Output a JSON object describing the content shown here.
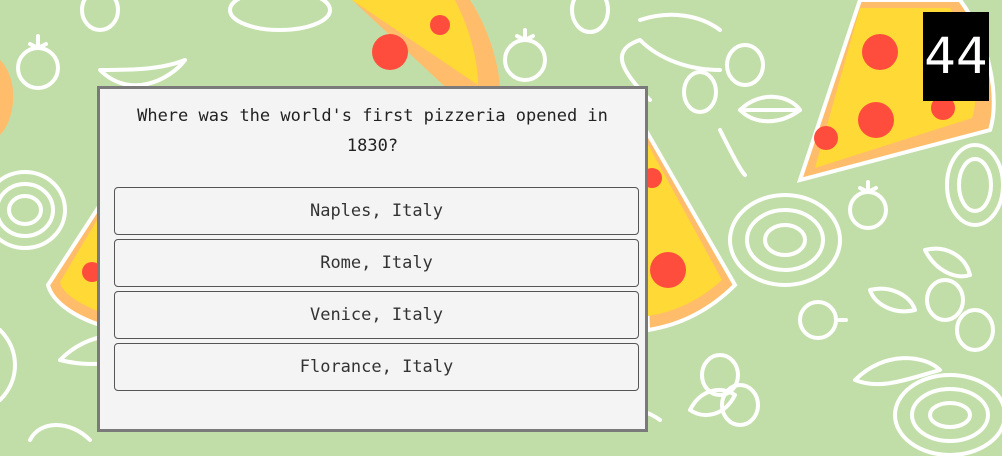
{
  "quiz": {
    "question": "Where was the world's first pizzeria opened in 1830?",
    "answers": [
      "Naples, Italy",
      "Rome, Italy",
      "Venice, Italy",
      "Florance, Italy"
    ]
  },
  "counter": {
    "value": "44"
  },
  "colors": {
    "background": "#c2dea8",
    "pattern_stroke": "#ffffff",
    "pizza_cheese": "#ffd935",
    "pizza_crust": "#ffbd6b",
    "pepperoni": "#ff4d3d",
    "card": "#f4f4f4",
    "card_border": "#7a7a7a",
    "counter_bg": "#000000",
    "counter_text": "#ffffff"
  },
  "background": {
    "pattern_icons": [
      "pizza-slice-icon",
      "tomato-icon",
      "olive-icon",
      "onion-icon",
      "pepper-icon",
      "basil-leaf-icon"
    ]
  }
}
